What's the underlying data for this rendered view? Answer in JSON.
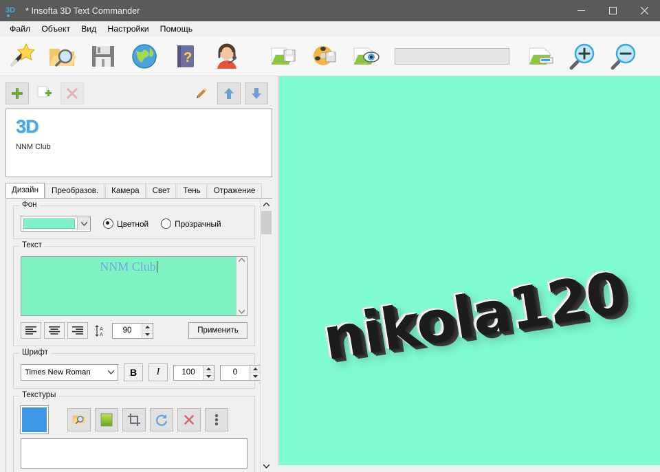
{
  "window": {
    "title": "* Insofta 3D Text Commander",
    "icon": "app-3d-icon",
    "controls": {
      "minimize": "minimize-icon",
      "maximize": "maximize-icon",
      "close": "close-icon"
    }
  },
  "menu": {
    "items": [
      {
        "label": "Файл",
        "name": "menu-file"
      },
      {
        "label": "Объект",
        "name": "menu-object"
      },
      {
        "label": "Вид",
        "name": "menu-view"
      },
      {
        "label": "Настройки",
        "name": "menu-settings"
      },
      {
        "label": "Помощь",
        "name": "menu-help"
      }
    ]
  },
  "toolbar": {
    "buttons_left": [
      {
        "name": "new-wizard-button",
        "icon": "magic-wand-icon"
      },
      {
        "name": "open-project-button",
        "icon": "open-folder-search-icon"
      },
      {
        "name": "save-project-button",
        "icon": "floppy-disk-icon"
      },
      {
        "name": "web-button",
        "icon": "globe-icon"
      },
      {
        "name": "help-button",
        "icon": "help-book-icon"
      },
      {
        "name": "support-button",
        "icon": "support-person-icon"
      }
    ],
    "buttons_right": [
      {
        "name": "save-image-button",
        "icon": "save-image-icon"
      },
      {
        "name": "save-animation-button",
        "icon": "film-reel-save-icon"
      },
      {
        "name": "preview-button",
        "icon": "preview-eye-icon"
      }
    ],
    "field": {
      "name": "toolbar-text-field",
      "value": "",
      "placeholder": ""
    },
    "buttons_end": [
      {
        "name": "export-button",
        "icon": "export-icon"
      },
      {
        "name": "zoom-in-button",
        "icon": "zoom-in-icon"
      },
      {
        "name": "zoom-out-button",
        "icon": "zoom-out-icon"
      }
    ]
  },
  "object_panel": {
    "buttons": [
      {
        "name": "add-object-button",
        "icon": "plus-icon"
      },
      {
        "name": "duplicate-object-button",
        "icon": "copy-plus-icon"
      },
      {
        "name": "delete-object-button",
        "icon": "red-x-icon"
      },
      {
        "name": "edit-object-button",
        "icon": "pencil-icon"
      },
      {
        "name": "move-up-button",
        "icon": "arrow-up-icon"
      },
      {
        "name": "move-down-button",
        "icon": "arrow-down-icon"
      }
    ],
    "items": [
      {
        "logo": "3D",
        "label": "NNM Club"
      }
    ]
  },
  "tabs": [
    {
      "label": "Дизайн",
      "active": true
    },
    {
      "label": "Преобразов.",
      "active": false
    },
    {
      "label": "Камера",
      "active": false
    },
    {
      "label": "Свет",
      "active": false
    },
    {
      "label": "Тень",
      "active": false
    },
    {
      "label": "Отражение",
      "active": false
    }
  ],
  "design": {
    "background": {
      "title": "Фон",
      "color": "#7ff3c3",
      "options": [
        {
          "label": "Цветной",
          "selected": true
        },
        {
          "label": "Прозрачный",
          "selected": false
        }
      ]
    },
    "text": {
      "title": "Текст",
      "value": "NNM Club",
      "background_color": "#7ff3c3",
      "text_color": "#6fa8dc",
      "align_buttons": [
        "align-left-icon",
        "align-center-icon",
        "align-right-icon"
      ],
      "line_spacing_icon": "line-spacing-icon",
      "line_spacing": "90",
      "apply_label": "Применить"
    },
    "font": {
      "title": "Шрифт",
      "family": "Times New Roman",
      "bold_label": "B",
      "italic_label": "I",
      "size": "100",
      "extra": "0"
    },
    "textures": {
      "title": "Текстуры",
      "swatch_color": "#3f97e8",
      "buttons": [
        {
          "name": "texture-browse-button",
          "icon": "open-folder-search-icon"
        },
        {
          "name": "texture-gradient-button",
          "icon": "gradient-square-icon"
        },
        {
          "name": "texture-crop-button",
          "icon": "crop-icon"
        },
        {
          "name": "texture-refresh-button",
          "icon": "refresh-icon"
        },
        {
          "name": "texture-delete-button",
          "icon": "red-x-icon"
        },
        {
          "name": "texture-more-button",
          "icon": "more-vertical-icon"
        }
      ]
    }
  },
  "preview": {
    "text": "nikola120",
    "background_color": "#7ffbd2",
    "text_color": "#1c1c1c"
  }
}
